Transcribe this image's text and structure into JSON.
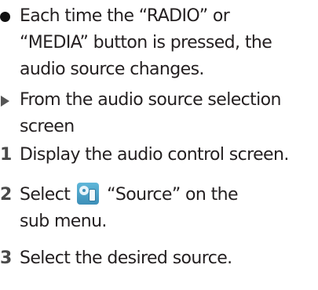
{
  "bullet": {
    "text": "Each time the “RADIO” or “MEDIA” button is pressed, the audio source changes."
  },
  "section": {
    "text": "From the audio source selection screen"
  },
  "steps": [
    {
      "number": "1",
      "text": "Display the audio control screen."
    },
    {
      "number": "2",
      "text_before": "Select",
      "text_after": "“Source” on the sub menu.",
      "icon": "source-icon"
    },
    {
      "number": "3",
      "text": "Select the desired source."
    }
  ]
}
